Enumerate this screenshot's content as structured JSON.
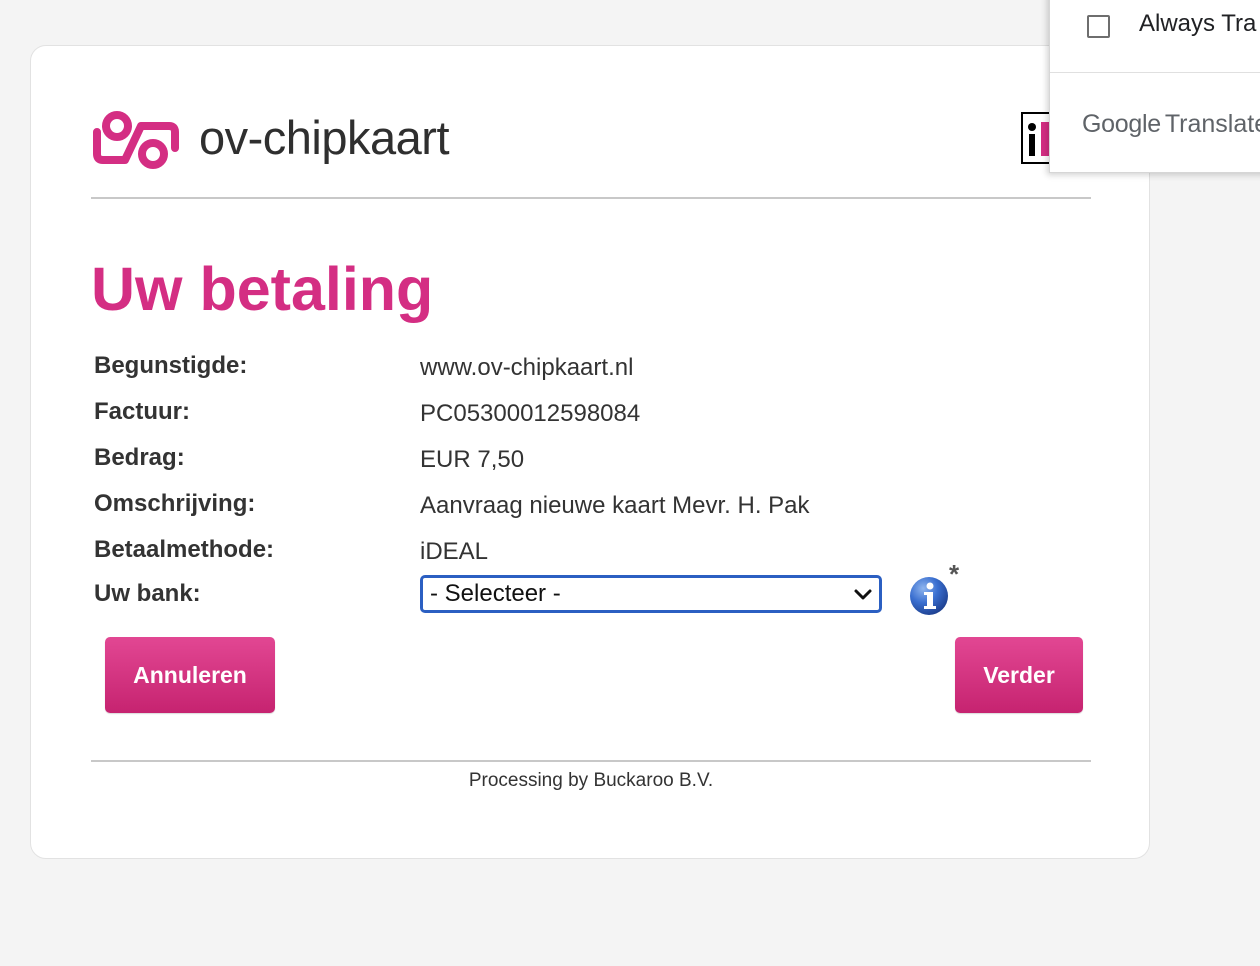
{
  "brand": {
    "logo_text": "ov-chipkaart",
    "accent_color": "#d42e83"
  },
  "page": {
    "title": "Uw betaling"
  },
  "details": [
    {
      "label": "Begunstigde:",
      "value": "www.ov-chipkaart.nl"
    },
    {
      "label": "Factuur:",
      "value": "PC05300012598084"
    },
    {
      "label": "Bedrag:",
      "value": "EUR 7,50"
    },
    {
      "label": "Omschrijving:",
      "value": "Aanvraag nieuwe kaart Mevr. H. Pak"
    },
    {
      "label": "Betaalmethode:",
      "value": "iDEAL"
    }
  ],
  "bank": {
    "label": "Uw bank:",
    "selected": "- Selecteer -",
    "info_icon": "info-icon",
    "required_marker": "*"
  },
  "buttons": {
    "cancel": "Annuleren",
    "next": "Verder"
  },
  "footer": {
    "text": "Processing by Buckaroo B.V."
  },
  "translate_popup": {
    "checkbox_label": "Always Tra",
    "brand_google": "Google",
    "brand_translate": "Translate"
  }
}
